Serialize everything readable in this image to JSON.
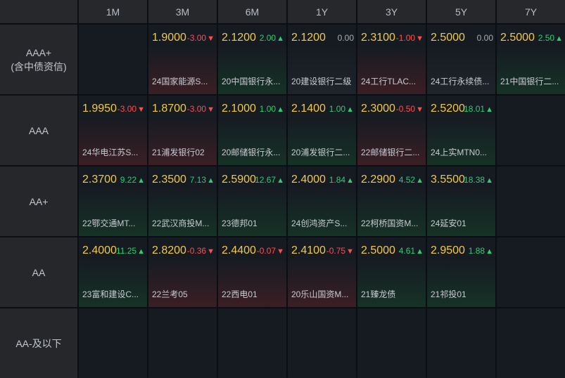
{
  "columns": [
    "1M",
    "3M",
    "6M",
    "1Y",
    "3Y",
    "5Y",
    "7Y"
  ],
  "rows": [
    {
      "label": "AAA+",
      "sublabel": "(含中债资信)",
      "cells": [
        null,
        {
          "price": "1.9000",
          "change": "-3.00",
          "dir": "down",
          "name": "24国家能源S..."
        },
        {
          "price": "2.1200",
          "change": "2.00",
          "dir": "up",
          "name": "20中国银行永..."
        },
        {
          "price": "2.1200",
          "change": "0.00",
          "dir": "flat",
          "name": "20建设银行二级"
        },
        {
          "price": "2.3100",
          "change": "-1.00",
          "dir": "down",
          "name": "24工行TLAC..."
        },
        {
          "price": "2.5000",
          "change": "0.00",
          "dir": "flat",
          "name": "24工行永续债..."
        },
        {
          "price": "2.5000",
          "change": "2.50",
          "dir": "up",
          "name": "21中国银行二..."
        }
      ]
    },
    {
      "label": "AAA",
      "sublabel": "",
      "cells": [
        {
          "price": "1.9950",
          "change": "-3.00",
          "dir": "down",
          "name": "24华电江苏S..."
        },
        {
          "price": "1.8700",
          "change": "-3.00",
          "dir": "down",
          "name": "21浦发银行02"
        },
        {
          "price": "2.1000",
          "change": "1.00",
          "dir": "up",
          "name": "20邮储银行永..."
        },
        {
          "price": "2.1400",
          "change": "1.00",
          "dir": "up",
          "name": "20浦发银行二..."
        },
        {
          "price": "2.3000",
          "change": "-0.50",
          "dir": "down",
          "name": "22邮储银行二..."
        },
        {
          "price": "2.5200",
          "change": "18.01",
          "dir": "up",
          "name": "24上实MTN0..."
        },
        null
      ]
    },
    {
      "label": "AA+",
      "sublabel": "",
      "cells": [
        {
          "price": "2.3700",
          "change": "9.22",
          "dir": "up",
          "name": "22鄂交通MT..."
        },
        {
          "price": "2.3500",
          "change": "7.13",
          "dir": "up",
          "name": "22武汉商投M..."
        },
        {
          "price": "2.5900",
          "change": "12.67",
          "dir": "up",
          "name": "23德邦01"
        },
        {
          "price": "2.4000",
          "change": "1.84",
          "dir": "up",
          "name": "24创鸿资产S..."
        },
        {
          "price": "2.2900",
          "change": "4.52",
          "dir": "up",
          "name": "22柯桥国资M..."
        },
        {
          "price": "3.5500",
          "change": "18.38",
          "dir": "up",
          "name": "24延安01"
        },
        null
      ]
    },
    {
      "label": "AA",
      "sublabel": "",
      "cells": [
        {
          "price": "2.4000",
          "change": "11.25",
          "dir": "up",
          "name": "23富和建设C..."
        },
        {
          "price": "2.8200",
          "change": "-0.36",
          "dir": "down",
          "name": "22兰考05"
        },
        {
          "price": "2.4400",
          "change": "-0.07",
          "dir": "down",
          "name": "22西电01"
        },
        {
          "price": "2.4100",
          "change": "-0.75",
          "dir": "down",
          "name": "20乐山国资M..."
        },
        {
          "price": "2.5000",
          "change": "4.61",
          "dir": "up",
          "name": "21臻龙债"
        },
        {
          "price": "2.9500",
          "change": "1.88",
          "dir": "up",
          "name": "21祁投01"
        },
        null
      ]
    },
    {
      "label": "AA-及以下",
      "sublabel": "",
      "cells": [
        null,
        null,
        null,
        null,
        null,
        null,
        null
      ]
    }
  ],
  "icons": {
    "up": "triangle-up-icon",
    "down": "triangle-down-icon"
  },
  "colors": {
    "price": "#f2c94c",
    "up": "#2ecc71",
    "down": "#ff4d4f",
    "flat": "#a9adb5"
  }
}
